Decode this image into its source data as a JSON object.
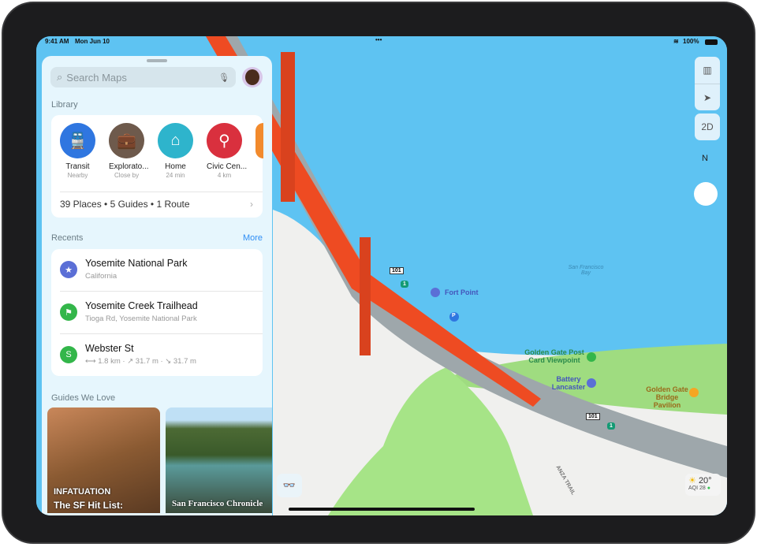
{
  "status": {
    "time": "9:41 AM",
    "date": "Mon Jun 10",
    "dots": "•••",
    "battery": "100%"
  },
  "search": {
    "placeholder": "Search Maps"
  },
  "library": {
    "heading": "Library",
    "items": [
      {
        "label": "Transit",
        "sub": "Nearby",
        "icon": "train-icon",
        "color": "#2f76e0"
      },
      {
        "label": "Explorato...",
        "sub": "Close by",
        "icon": "briefcase-icon",
        "color": "#6e5a4c"
      },
      {
        "label": "Home",
        "sub": "24 min",
        "icon": "house-icon",
        "color": "#2eb4cc"
      },
      {
        "label": "Civic Cen...",
        "sub": "4 km",
        "icon": "pin-icon",
        "color": "#d9303e"
      }
    ],
    "summary": "39 Places • 5 Guides • 1 Route"
  },
  "recents": {
    "heading": "Recents",
    "more": "More",
    "items": [
      {
        "title": "Yosemite National Park",
        "sub": "California",
        "icon": "star-icon",
        "color": "#5b6fd6"
      },
      {
        "title": "Yosemite Creek Trailhead",
        "sub": "Tioga Rd, Yosemite National Park",
        "icon": "trail-sign-icon",
        "color": "#33b64a"
      },
      {
        "title": "Webster St",
        "sub": "⟷ 1.8 km · ↗ 31.7 m · ↘ 31.7 m",
        "icon": "route-icon",
        "color": "#33b64a"
      }
    ]
  },
  "guides": {
    "heading": "Guides We Love",
    "items": [
      {
        "publisher": "INFATUATION",
        "title": "The SF Hit List:"
      },
      {
        "publisher": "San Francisco Chronicle",
        "title": ""
      }
    ]
  },
  "map_controls": {
    "mode": "2D",
    "compass": "N"
  },
  "map_labels": {
    "fort_point": "Fort Point",
    "bay": "San Francisco Bay",
    "viewpoint": "Golden Gate Post Card Viewpoint",
    "battery": "Battery Lancaster",
    "pavilion": "Golden Gate Bridge Pavilion",
    "anza": "ANZA TRAIL",
    "hwy101": "101",
    "hwy1": "1",
    "parking": "P"
  },
  "weather": {
    "temp": "20°",
    "aqi": "AQI 28"
  }
}
